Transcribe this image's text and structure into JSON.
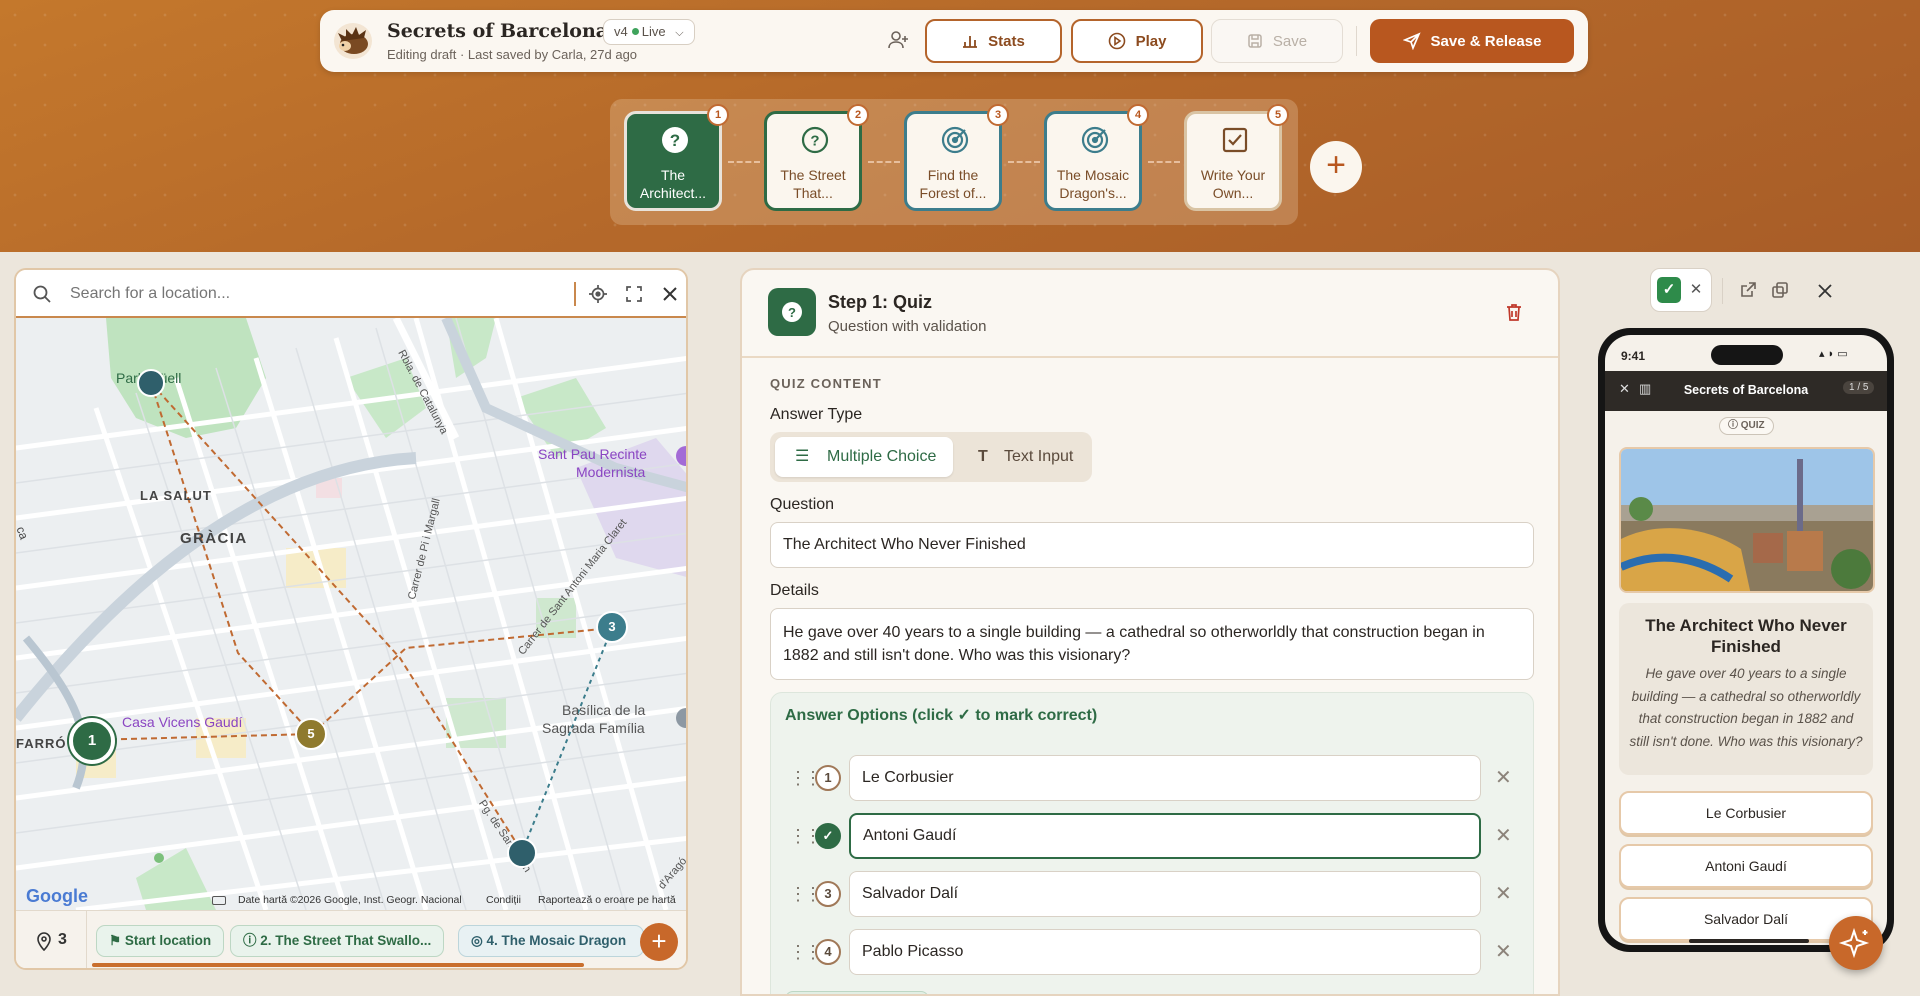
{
  "colors": {
    "accent": "#b8571f",
    "green": "#2e6b45",
    "banner": "#b5692a"
  },
  "header": {
    "title": "Secrets of Barcelona",
    "subtitle": "Editing draft · Last saved by Carla, 27d ago",
    "version": "v4",
    "version_status": "Live",
    "stats": "Stats",
    "play": "Play",
    "save": "Save",
    "save_release": "Save & Release"
  },
  "steps": [
    {
      "num": "1",
      "line1": "The",
      "line2": "Architect...",
      "icon": "question-icon"
    },
    {
      "num": "2",
      "line1": "The Street",
      "line2": "That...",
      "icon": "question-icon"
    },
    {
      "num": "3",
      "line1": "Find the",
      "line2": "Forest of...",
      "icon": "target-icon"
    },
    {
      "num": "4",
      "line1": "The Mosaic",
      "line2": "Dragon's...",
      "icon": "target-icon"
    },
    {
      "num": "5",
      "line1": "Write Your",
      "line2": "Own...",
      "icon": "checkbox-icon"
    }
  ],
  "map": {
    "search_placeholder": "Search for a location...",
    "places": {
      "park": "Park Güell",
      "salut": "LA SALUT",
      "gracia": "GRÀCIA",
      "santpau1": "Sant Pau Recinte",
      "santpau2": "Modernista",
      "vicens": "Casa Vicens Gaudí",
      "sagrada1": "Basílica de la",
      "sagrada2": "Sagrada Família",
      "farro": "FARRÓ",
      "ca": "ca",
      "catalunya": "Rbla. de Catalunya",
      "pimargall": "Carrer de Pi i Margall",
      "clare": "Carrer de Sant Antoni Maria Claret",
      "pgsant": "Pg. de Sant Joan",
      "aragó": "d'Aragó"
    },
    "markers": [
      "1",
      "3",
      "5"
    ],
    "google": "Google",
    "attribution": "Date hartă ©2026 Google, Inst. Geogr. Nacional",
    "terms": "Condiții",
    "report": "Raportează o eroare pe hartă",
    "pin_count": "3",
    "chips": [
      "Start location",
      "2. The Street That Swallo...",
      "4. The Mosaic Dragon"
    ]
  },
  "editor": {
    "step_title": "Step 1: Quiz",
    "step_subtitle": "Question with validation",
    "section": "QUIZ CONTENT",
    "answer_type_label": "Answer Type",
    "mc": "Multiple Choice",
    "text_input": "Text Input",
    "question_label": "Question",
    "question": "The Architect Who Never Finished",
    "details_label": "Details",
    "details_line1": "He gave over 40 years to a single building — a cathedral so otherworldly that construction began in",
    "details_line2": "1882 and still isn't done. Who was this visionary?",
    "options_title": "Answer Options (click ✓ to mark correct)",
    "options": [
      {
        "num": "1",
        "text": "Le Corbusier"
      },
      {
        "num": "",
        "text": "Antoni Gaudí"
      },
      {
        "num": "3",
        "text": "Salvador Dalí"
      },
      {
        "num": "4",
        "text": "Pablo Picasso"
      }
    ]
  },
  "phone": {
    "time": "9:41",
    "title": "Secrets of Barcelona",
    "page": "1 / 5",
    "badge": "QUIZ",
    "question": "The Architect Who Never Finished",
    "details": "He gave over 40 years to a single building — a cathedral so otherworldly that construction began in 1882 and still isn't done. Who was this visionary?",
    "options": [
      "Le Corbusier",
      "Antoni Gaudí",
      "Salvador Dalí"
    ]
  }
}
